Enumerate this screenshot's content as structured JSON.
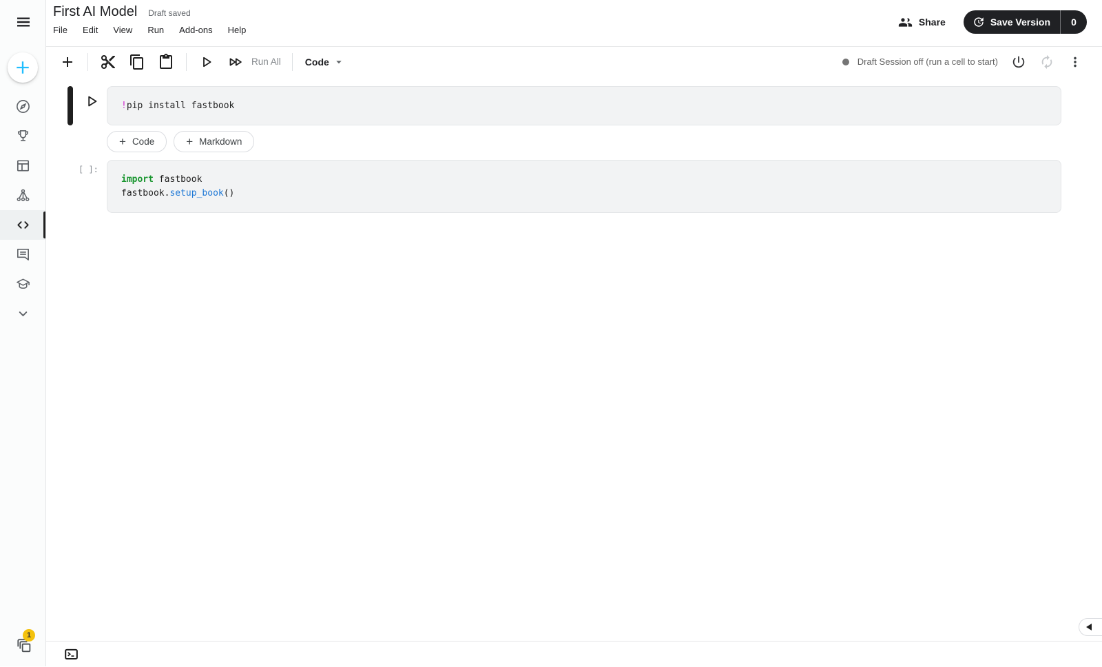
{
  "header": {
    "title": "First AI Model",
    "draft_status": "Draft saved",
    "menu_items": [
      "File",
      "Edit",
      "View",
      "Run",
      "Add-ons",
      "Help"
    ],
    "share_label": "Share",
    "save_version_label": "Save Version",
    "version_count": "0"
  },
  "toolbar": {
    "run_all_label": "Run All",
    "cell_type": "Code",
    "session_status": "Draft Session off (run a cell to start)"
  },
  "sidebar": {
    "items": [
      {
        "name": "create",
        "icon": "plus-icon"
      },
      {
        "name": "explore",
        "icon": "compass-icon"
      },
      {
        "name": "competitions",
        "icon": "trophy-icon"
      },
      {
        "name": "datasets",
        "icon": "table-icon"
      },
      {
        "name": "models",
        "icon": "network-icon"
      },
      {
        "name": "code",
        "icon": "code-icon",
        "active": true
      },
      {
        "name": "discussions",
        "icon": "comment-icon"
      },
      {
        "name": "learn",
        "icon": "graduation-cap-icon"
      },
      {
        "name": "more",
        "icon": "chevron-down-icon"
      }
    ],
    "active_events_badge": "1"
  },
  "cells": [
    {
      "type": "code",
      "selected": true,
      "lines": [
        {
          "tokens": [
            {
              "type": "magic",
              "text": "!"
            },
            {
              "type": "plain",
              "text": "pip install fastbook"
            }
          ]
        }
      ]
    },
    {
      "type": "code",
      "prompt": "[ ]:",
      "lines": [
        {
          "tokens": [
            {
              "type": "keyword",
              "text": "import"
            },
            {
              "type": "plain",
              "text": " fastbook"
            }
          ]
        },
        {
          "tokens": [
            {
              "type": "plain",
              "text": "fastbook."
            },
            {
              "type": "function",
              "text": "setup_book"
            },
            {
              "type": "plain",
              "text": "()"
            }
          ]
        }
      ]
    }
  ],
  "cell_actions": {
    "plus": "+",
    "add_code_label": "Code",
    "add_markdown_label": "Markdown"
  },
  "colors": {
    "accent_cyan": "#20beff",
    "badge_yellow": "#f4c20d",
    "save_button_bg": "#202124",
    "code_cell_bg": "#f2f3f4",
    "syntax_magic": "#d02fd0",
    "syntax_keyword": "#18952e",
    "syntax_function": "#1e78d6",
    "code_text": "#212121",
    "icon_gray": "#5f6368",
    "session_dot_gray": "#757575"
  }
}
